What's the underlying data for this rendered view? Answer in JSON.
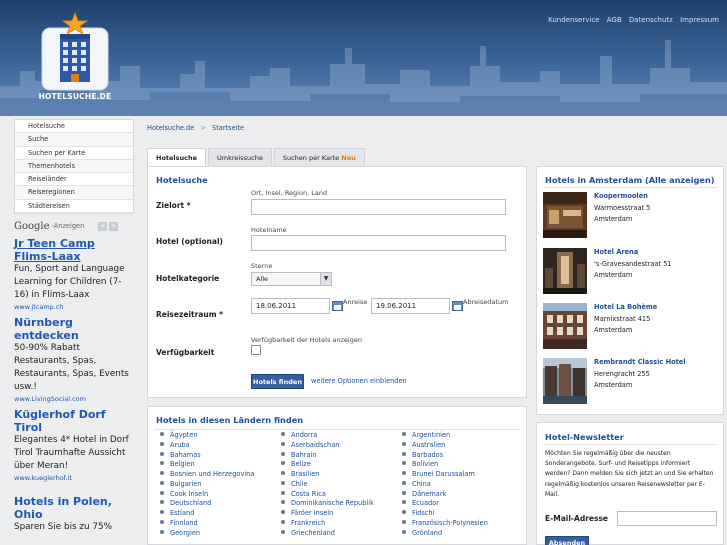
{
  "header": {
    "logo_text": "HOTELSUCHE.DE",
    "top_links": [
      "Kundenservice",
      "AGB",
      "Datenschutz",
      "Impressum"
    ]
  },
  "sidebar": {
    "items": [
      {
        "label": "Hotelsuche"
      },
      {
        "label": "Suche"
      },
      {
        "label": "Suchen per Karte"
      },
      {
        "label": "Themenhotels"
      },
      {
        "label": "Reiseländer"
      },
      {
        "label": "Reiseregionen"
      },
      {
        "label": "Städtereisen"
      }
    ]
  },
  "ads": {
    "google_word": "Google",
    "label": "-Anzeigen",
    "prev_symbol": "<",
    "next_symbol": ">",
    "items": [
      {
        "title": "Jr Teen Camp Flims-Laax",
        "text": "Fun, Sport and Language Learning for Children (7-16) in Flims-Laax",
        "url": "www.jtcamp.ch"
      },
      {
        "title": "Nürnberg entdecken",
        "text": "50-90% Rabatt Restaurants, Spas, Restaurants, Spas, Events usw.!",
        "url": "www.LivingSocial.com"
      },
      {
        "title": "Küglerhof Dorf Tirol",
        "text": "Elegantes 4* Hotel in Dorf Tirol Traumhafte Aussicht über Meran!",
        "url": "www.kueglerhof.it"
      },
      {
        "title": "Hotels in Polen, Ohio",
        "text": "Sparen Sie bis zu 75%",
        "url": ""
      }
    ]
  },
  "breadcrumb": {
    "home": "Hotelsuche.de",
    "separator": ">",
    "current": "Startseite"
  },
  "tabs": [
    {
      "label": "Hotelsuche",
      "badge": ""
    },
    {
      "label": "Umkreissuche",
      "badge": ""
    },
    {
      "label": "Suchen per Karte",
      "badge": "Neu"
    }
  ],
  "search": {
    "title": "Hotelsuche",
    "destination_label": "Zielort *",
    "destination_hint": "Ort, Insel, Region, Land",
    "destination_value": "",
    "hotel_label": "Hotel (optional)",
    "hotel_hint": "Hotelname",
    "hotel_value": "",
    "category_label": "Hotelkategorie",
    "category_hint": "Sterne",
    "category_value": "Alle",
    "period_label": "Reisezeitraum *",
    "arrival_value": "18.06.2011",
    "arrival_label": "Anreise",
    "departure_value": "19.06.2011",
    "departure_label": "Abreisedatum",
    "availability_label": "Verfügbarkeit",
    "availability_hint": "Verfügbarkeit der Hotels anzeigen",
    "submit_label": "Hotels finden",
    "more_options_label": "weitere Optionen einblenden"
  },
  "countries": {
    "title": "Hotels in diesen Ländern finden",
    "columns": [
      [
        "Ägypten",
        "Aruba",
        "Bahamas",
        "Belgien",
        "Bosnien und Herzegovina",
        "Bulgarien",
        "Cook Inseln",
        "Deutschland",
        "Estland",
        "Finnland",
        "Georgien"
      ],
      [
        "Andorra",
        "Aserbaidschan",
        "Bahrain",
        "Belize",
        "Brasilien",
        "Chile",
        "Costa Rica",
        "Dominikanische Republik",
        "Färöer Inseln",
        "Frankreich",
        "Griechenland"
      ],
      [
        "Argentinien",
        "Australien",
        "Barbados",
        "Bolivien",
        "Brunei Darussalam",
        "China",
        "Dänemark",
        "Ecuador",
        "Fidschi",
        "Französisch-Polynesien",
        "Grönland"
      ]
    ]
  },
  "hotels": {
    "title": "Hotels in Amsterdam (Alle anzeigen)",
    "items": [
      {
        "name": "Koopermoolen",
        "street": "Warmoesstraat 5",
        "city": "Amsterdam"
      },
      {
        "name": "Hotel Arena",
        "street": "'s-Gravesandestraat 51",
        "city": "Amsterdam"
      },
      {
        "name": "Hotel La Bohème",
        "street": "Marnixstraat 415",
        "city": "Amsterdam"
      },
      {
        "name": "Rembrandt Classic Hotel",
        "street": "Herengracht 255",
        "city": "Amsterdam"
      }
    ]
  },
  "newsletter": {
    "title": "Hotel-Newsletter",
    "text": "Möchten Sie regelmäßig über die neusten Sonderangebote, Surf- und Reisetipps informiert werden? Dann melden Sie sich jetzt an und Sie erhalten regelmäßig kostenlos unseren Reisenewsletter per E-Mail.",
    "email_label": "E-Mail-Adresse",
    "email_value": "",
    "submit_label": "Absenden"
  }
}
